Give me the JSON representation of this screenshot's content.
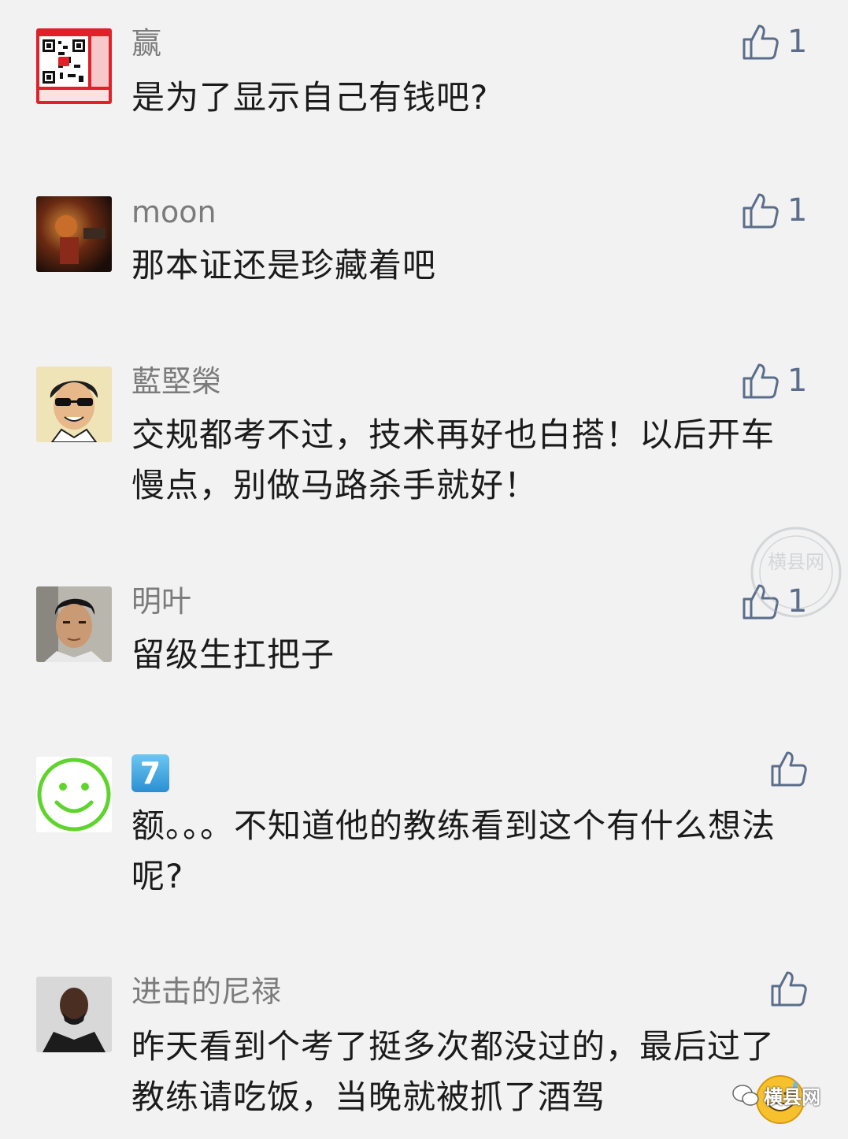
{
  "comments": [
    {
      "nickname": "赢",
      "text": "是为了显示自己有钱吧?",
      "likes": "1"
    },
    {
      "nickname": "moon",
      "text": "那本证还是珍藏着吧",
      "likes": "1"
    },
    {
      "nickname": "藍堅榮",
      "text": "交规都考不过，技术再好也白搭！以后开车慢点，别做马路杀手就好！",
      "likes": "1"
    },
    {
      "nickname": "明叶",
      "text": "留级生扛把子",
      "likes": "1"
    },
    {
      "nickname": "7",
      "text": "额。。。不知道他的教练看到这个有什么想法呢?",
      "likes": ""
    },
    {
      "nickname": "进击的尼禄",
      "text": "昨天看到个考了挺多次都没过的，最后过了教练请吃饭，当晚就被抓了酒驾",
      "likes": ""
    }
  ],
  "watermark": {
    "text": "横县网"
  },
  "brand": {
    "label": "横县网"
  },
  "colors": {
    "background": "#f2f2f2",
    "nickname": "#7b7b7b",
    "text": "#1b1b1b",
    "like": "#5a6d8a"
  },
  "icons": {
    "like": "thumbs-up-icon",
    "brand": "wechat-logo-icon",
    "emoji": "sweat-smile-emoji-icon"
  }
}
